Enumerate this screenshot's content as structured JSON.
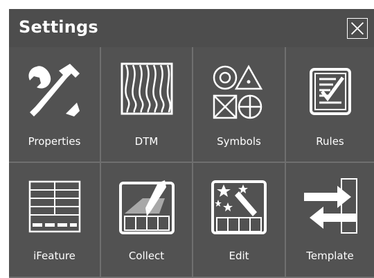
{
  "window": {
    "title": "Settings"
  },
  "tiles": [
    {
      "label": "Properties",
      "icon": "wrench-hammer-icon"
    },
    {
      "label": "DTM",
      "icon": "dtm-contours-icon"
    },
    {
      "label": "Symbols",
      "icon": "symbols-icon"
    },
    {
      "label": "Rules",
      "icon": "rules-checklist-icon"
    },
    {
      "label": "iFeature",
      "icon": "table-grid-icon"
    },
    {
      "label": "Collect",
      "icon": "pen-collect-icon"
    },
    {
      "label": "Edit",
      "icon": "magic-wand-edit-icon"
    },
    {
      "label": "Template",
      "icon": "swap-arrows-icon"
    }
  ]
}
